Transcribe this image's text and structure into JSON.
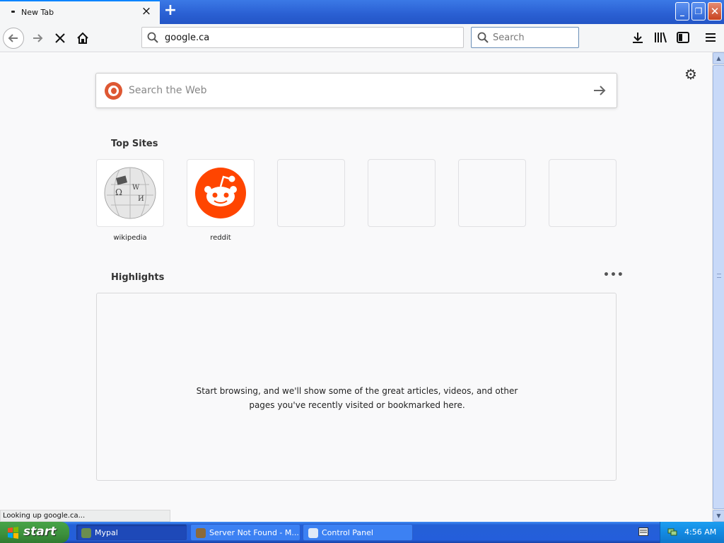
{
  "window": {
    "tab_title": "New Tab",
    "tab_close": "×",
    "new_tab": "+",
    "min": "_",
    "max": "❐",
    "close": "✕"
  },
  "navbar": {
    "url": "google.ca",
    "search_placeholder": "Search"
  },
  "newtab": {
    "search_placeholder": "Search the Web",
    "top_sites_title": "Top Sites",
    "top_sites": [
      {
        "label": "wikipedia",
        "icon": "wikipedia-globe-icon"
      },
      {
        "label": "reddit",
        "icon": "reddit-alien-icon",
        "color": "#ff4500"
      },
      {
        "label": ""
      },
      {
        "label": ""
      },
      {
        "label": ""
      },
      {
        "label": ""
      }
    ],
    "highlights_title": "Highlights",
    "highlights_more": "•••",
    "highlights_message": "Start browsing, and we'll show some of the great articles, videos, and other pages you've recently visited or bookmarked here."
  },
  "status_text": "Looking up google.ca...",
  "taskbar": {
    "start_label": "start",
    "tasks": [
      {
        "label": "Mypal",
        "active": true
      },
      {
        "label": "Server Not Found - M...",
        "active": false
      },
      {
        "label": "Control Panel",
        "active": false
      }
    ],
    "clock": "4:56 AM"
  },
  "colors": {
    "accent": "#0a84ff",
    "xp_blue": "#245edb",
    "start_green": "#3c8f3c",
    "ddg": "#de5833",
    "reddit": "#ff4500"
  }
}
